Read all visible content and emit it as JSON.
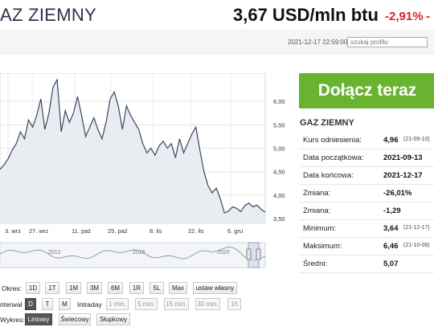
{
  "header": {
    "title": "AZ ZIEMNY",
    "price": "3,67 USD/mln btu",
    "change_pct": "-2,91%",
    "change_abs": "-"
  },
  "subbar": {
    "timestamp": "2021-12-17 22:59:00",
    "search_placeholder": "szukaj profilu"
  },
  "join_button": "Dołącz teraz",
  "side": {
    "title": "GAZ ZIEMNY",
    "rows": [
      {
        "label": "Kurs odniesienia:",
        "value": "4,96",
        "date": "(21-09-10)"
      },
      {
        "label": "Data początkowa:",
        "value": "2021-09-13",
        "date": ""
      },
      {
        "label": "Data końcowa:",
        "value": "2021-12-17",
        "date": ""
      },
      {
        "label": "Zmiana:",
        "value": "-26,01%",
        "date": ""
      },
      {
        "label": "Zmiana:",
        "value": "-1,29",
        "date": ""
      },
      {
        "label": "Minimum:",
        "value": "3,64",
        "date": "(21-12-17)"
      },
      {
        "label": "Maksimum:",
        "value": "6,46",
        "date": "(21-10-06)"
      },
      {
        "label": "Średni:",
        "value": "5,07",
        "date": ""
      }
    ]
  },
  "controls": {
    "okres_label": "Okres:",
    "okres_buttons": [
      "1D",
      "1T",
      "1M",
      "3M",
      "6M",
      "1R",
      "5L",
      "Max",
      "ustaw własny"
    ],
    "interwal_label": "nterwał",
    "interwal_buttons": [
      "D",
      "T",
      "M"
    ],
    "intraday_label": "Intraday",
    "intraday_buttons": [
      "1 min.",
      "5 min.",
      "15 min.",
      "30 min.",
      "1h"
    ],
    "wykres_label": "Wykres:",
    "wykres_buttons": [
      "Liniowy",
      "Świecowy",
      "Słupkowy"
    ]
  },
  "chart_data": {
    "type": "line",
    "x_tick_labels": [
      "3. wrz",
      "27. wrz",
      "11. paź",
      "25. paź",
      "8. lis",
      "22. lis",
      "6. gru"
    ],
    "y_tick_labels": [
      "6,00",
      "5,50",
      "5,00",
      "4,50",
      "4,00",
      "3,50"
    ],
    "ylim": [
      3.4,
      6.6
    ],
    "grid": true,
    "navigator_labels": [
      "2012",
      "2016",
      "2020"
    ],
    "series": [
      {
        "values": [
          4.55,
          4.65,
          4.78,
          4.96,
          5.1,
          5.35,
          5.2,
          5.6,
          5.45,
          5.7,
          6.05,
          5.4,
          5.75,
          6.3,
          6.46,
          5.35,
          5.8,
          5.55,
          5.75,
          6.1,
          5.7,
          5.25,
          5.45,
          5.65,
          5.4,
          5.2,
          5.55,
          6.05,
          6.2,
          5.9,
          5.4,
          5.9,
          5.7,
          5.55,
          5.4,
          5.1,
          4.9,
          5.0,
          4.85,
          5.05,
          5.15,
          5.0,
          5.1,
          4.8,
          5.2,
          4.9,
          5.1,
          5.3,
          5.45,
          4.95,
          4.5,
          4.2,
          4.05,
          4.15,
          3.92,
          3.62,
          3.66,
          3.75,
          3.72,
          3.65,
          3.78,
          3.83,
          3.75,
          3.79,
          3.7,
          3.64
        ]
      }
    ]
  },
  "colors": {
    "accent_green": "#68b330",
    "negative_red": "#d3242a",
    "chart_line": "#3a4660",
    "chart_fill": "#e9edf2"
  }
}
